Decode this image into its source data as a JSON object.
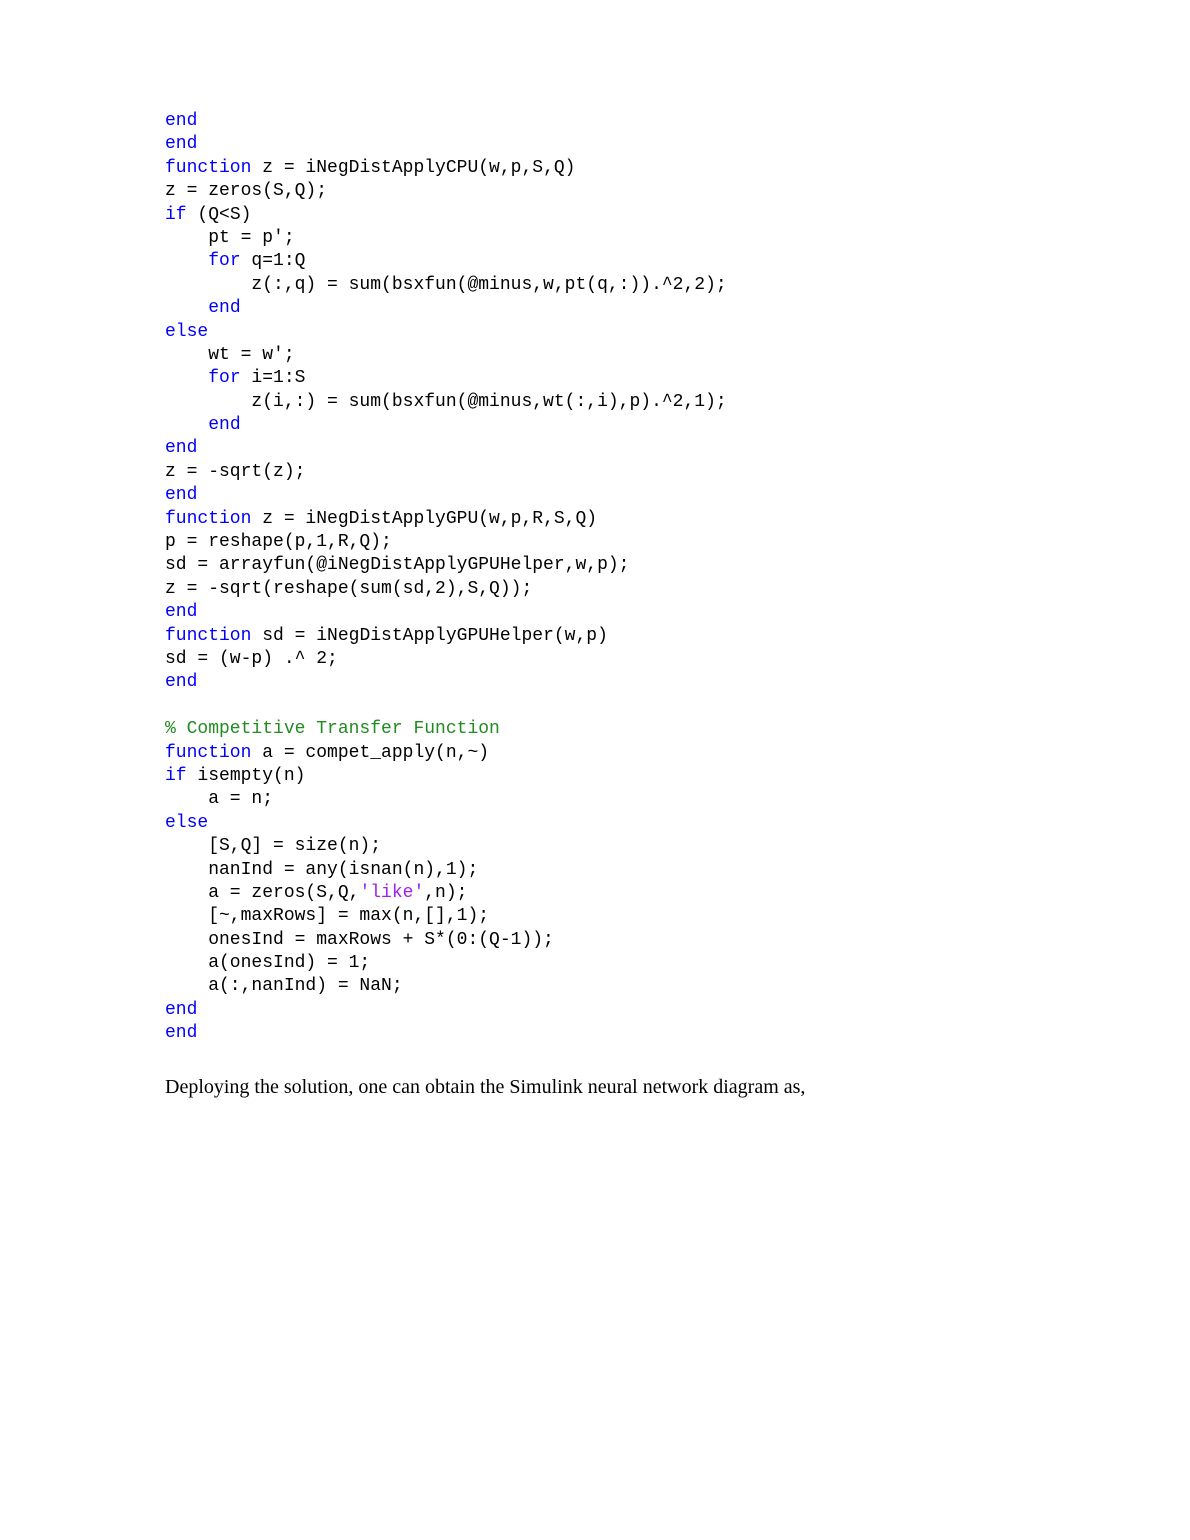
{
  "code": {
    "lines": [
      [
        {
          "cls": "kw",
          "t": "end"
        }
      ],
      [
        {
          "cls": "kw",
          "t": "end"
        }
      ],
      [
        {
          "cls": "kw",
          "t": "function"
        },
        {
          "cls": "plain",
          "t": " z = iNegDistApplyCPU(w,p,S,Q)"
        }
      ],
      [
        {
          "cls": "plain",
          "t": "z = zeros(S,Q);"
        }
      ],
      [
        {
          "cls": "kw",
          "t": "if"
        },
        {
          "cls": "plain",
          "t": " (Q<S)"
        }
      ],
      [
        {
          "cls": "plain",
          "t": "    pt = p';"
        }
      ],
      [
        {
          "cls": "plain",
          "t": "    "
        },
        {
          "cls": "kw",
          "t": "for"
        },
        {
          "cls": "plain",
          "t": " q=1:Q"
        }
      ],
      [
        {
          "cls": "plain",
          "t": "        z(:,q) = sum(bsxfun(@minus,w,pt(q,:)).^2,2);"
        }
      ],
      [
        {
          "cls": "plain",
          "t": "    "
        },
        {
          "cls": "kw",
          "t": "end"
        }
      ],
      [
        {
          "cls": "kw",
          "t": "else"
        }
      ],
      [
        {
          "cls": "plain",
          "t": "    wt = w';"
        }
      ],
      [
        {
          "cls": "plain",
          "t": "    "
        },
        {
          "cls": "kw",
          "t": "for"
        },
        {
          "cls": "plain",
          "t": " i=1:S"
        }
      ],
      [
        {
          "cls": "plain",
          "t": "        z(i,:) = sum(bsxfun(@minus,wt(:,i),p).^2,1);"
        }
      ],
      [
        {
          "cls": "plain",
          "t": "    "
        },
        {
          "cls": "kw",
          "t": "end"
        }
      ],
      [
        {
          "cls": "kw",
          "t": "end"
        }
      ],
      [
        {
          "cls": "plain",
          "t": "z = -sqrt(z);"
        }
      ],
      [
        {
          "cls": "kw",
          "t": "end"
        }
      ],
      [
        {
          "cls": "kw",
          "t": "function"
        },
        {
          "cls": "plain",
          "t": " z = iNegDistApplyGPU(w,p,R,S,Q)"
        }
      ],
      [
        {
          "cls": "plain",
          "t": "p = reshape(p,1,R,Q);"
        }
      ],
      [
        {
          "cls": "plain",
          "t": "sd = arrayfun(@iNegDistApplyGPUHelper,w,p);"
        }
      ],
      [
        {
          "cls": "plain",
          "t": "z = -sqrt(reshape(sum(sd,2),S,Q));"
        }
      ],
      [
        {
          "cls": "kw",
          "t": "end"
        }
      ],
      [
        {
          "cls": "kw",
          "t": "function"
        },
        {
          "cls": "plain",
          "t": " sd = iNegDistApplyGPUHelper(w,p)"
        }
      ],
      [
        {
          "cls": "plain",
          "t": "sd = (w-p) .^ 2;"
        }
      ],
      [
        {
          "cls": "kw",
          "t": "end"
        }
      ],
      [
        {
          "cls": "plain",
          "t": ""
        }
      ],
      [
        {
          "cls": "com",
          "t": "% Competitive Transfer Function"
        }
      ],
      [
        {
          "cls": "kw",
          "t": "function"
        },
        {
          "cls": "plain",
          "t": " a = compet_apply(n,~)"
        }
      ],
      [
        {
          "cls": "kw",
          "t": "if"
        },
        {
          "cls": "plain",
          "t": " isempty(n)"
        }
      ],
      [
        {
          "cls": "plain",
          "t": "    a = n;"
        }
      ],
      [
        {
          "cls": "kw",
          "t": "else"
        }
      ],
      [
        {
          "cls": "plain",
          "t": "    [S,Q] = size(n);"
        }
      ],
      [
        {
          "cls": "plain",
          "t": "    nanInd = any(isnan(n),1);"
        }
      ],
      [
        {
          "cls": "plain",
          "t": "    a = zeros(S,Q,"
        },
        {
          "cls": "str",
          "t": "'like'"
        },
        {
          "cls": "plain",
          "t": ",n);"
        }
      ],
      [
        {
          "cls": "plain",
          "t": "    [~,maxRows] = max(n,[],1);"
        }
      ],
      [
        {
          "cls": "plain",
          "t": "    onesInd = maxRows + S*(0:(Q-1));"
        }
      ],
      [
        {
          "cls": "plain",
          "t": "    a(onesInd) = 1;"
        }
      ],
      [
        {
          "cls": "plain",
          "t": "    a(:,nanInd) = NaN;"
        }
      ],
      [
        {
          "cls": "kw",
          "t": "end"
        }
      ],
      [
        {
          "cls": "kw",
          "t": "end"
        }
      ]
    ]
  },
  "prose": {
    "text": "Deploying the solution, one can obtain the Simulink neural network diagram as,"
  }
}
